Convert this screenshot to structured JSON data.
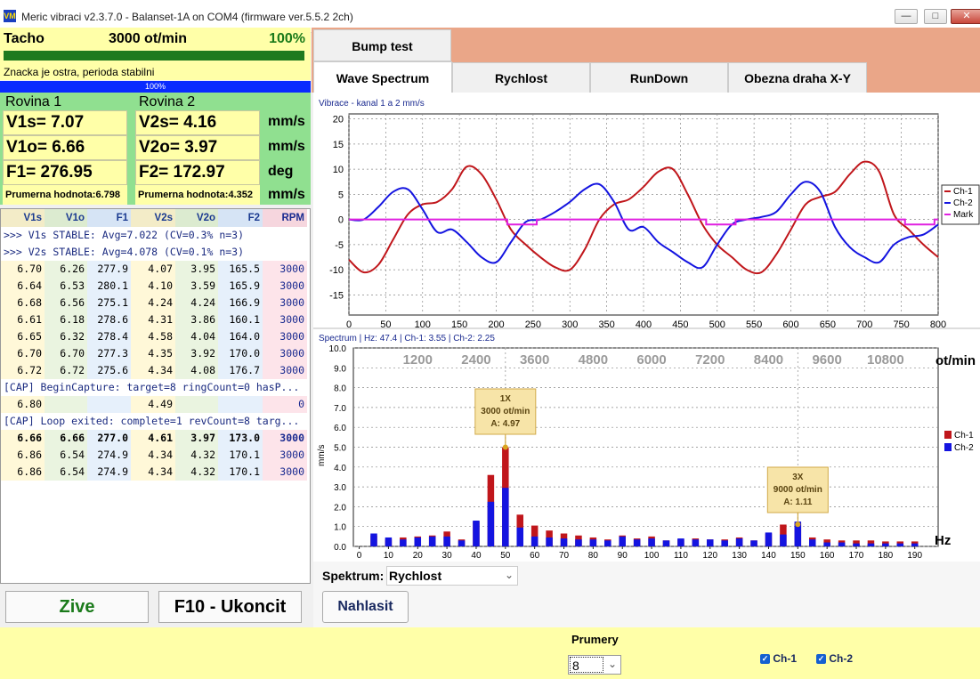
{
  "window": {
    "title": "Meric vibraci v2.3.7.0 - Balanset-1A on COM4 (firmware ver.5.5.2 2ch)",
    "logo_text": "VM"
  },
  "tacho": {
    "label": "Tacho",
    "rpm": "3000 ot/min",
    "percent": "100%",
    "message": "Znacka je ostra, perioda stabilni",
    "progress_label": "100%",
    "progress": 1.0
  },
  "planes": {
    "plane1": {
      "title": "Rovina 1",
      "v1s": "V1s= 7.07",
      "v1o": "V1o= 6.66",
      "f1": "F1= 276.95",
      "avg": "Prumerna hodnota:6.798"
    },
    "plane2": {
      "title": "Rovina 2",
      "v2s": "V2s= 4.16",
      "v2o": "V2o= 3.97",
      "f2": "F2= 172.97",
      "avg": "Prumerna hodnota:4.352"
    },
    "units": [
      "mm/s",
      "mm/s",
      "deg",
      "mm/s"
    ]
  },
  "table": {
    "headers": [
      "V1s",
      "V1o",
      "F1",
      "V2s",
      "V2o",
      "F2",
      "RPM"
    ],
    "log1": ">>> V1s STABLE: Avg=7.022 (CV=0.3% n=3)",
    "log2": ">>> V2s STABLE: Avg=4.078 (CV=0.1% n=3)",
    "rows_a": [
      [
        "6.70",
        "6.26",
        "277.9",
        "4.07",
        "3.95",
        "165.5",
        "3000"
      ],
      [
        "6.64",
        "6.53",
        "280.1",
        "4.10",
        "3.59",
        "165.9",
        "3000"
      ],
      [
        "6.68",
        "6.56",
        "275.1",
        "4.24",
        "4.24",
        "166.9",
        "3000"
      ],
      [
        "6.61",
        "6.18",
        "278.6",
        "4.31",
        "3.86",
        "160.1",
        "3000"
      ],
      [
        "6.65",
        "6.32",
        "278.4",
        "4.58",
        "4.04",
        "164.0",
        "3000"
      ],
      [
        "6.70",
        "6.70",
        "277.3",
        "4.35",
        "3.92",
        "170.0",
        "3000"
      ],
      [
        "6.72",
        "6.72",
        "275.6",
        "4.34",
        "4.08",
        "176.7",
        "3000"
      ]
    ],
    "log3": "[CAP] BeginCapture: target=8 ringCount=0 hasP...",
    "row_b": [
      "6.80",
      "",
      "",
      "4.49",
      "",
      "",
      "0"
    ],
    "log4": "[CAP] Loop exited: complete=1 revCount=8 targ...",
    "rows_c": [
      [
        "6.66",
        "6.66",
        "277.0",
        "4.61",
        "3.97",
        "173.0",
        "3000"
      ],
      [
        "6.86",
        "6.54",
        "274.9",
        "4.34",
        "4.32",
        "170.1",
        "3000"
      ],
      [
        "6.86",
        "6.54",
        "274.9",
        "4.34",
        "4.32",
        "170.1",
        "3000"
      ]
    ]
  },
  "buttons": {
    "live": "Zive",
    "quit": "F10 - Ukoncit",
    "report": "Nahlasit"
  },
  "tabs": {
    "bump": "Bump test",
    "wave": "Wave Spectrum",
    "speed": "Rychlost",
    "rundown": "RunDown",
    "orbit": "Obezna draha X-Y"
  },
  "spectrum_select": {
    "label": "Spektrum:",
    "value": "Rychlost"
  },
  "averages": {
    "label": "Prumery",
    "value": "8"
  },
  "channels": {
    "ch1": "Ch-1",
    "ch2": "Ch-2"
  },
  "colors": {
    "ch1": "#c0161b",
    "ch2": "#1414e0",
    "mark": "#e020e0",
    "tabs_bg": "#eaa688",
    "panel_yellow": "#ffffa8",
    "panel_green": "#90e090"
  },
  "chart_data": [
    {
      "type": "line",
      "title": "Vibrace  - kanal 1 a 2 mm/s",
      "xlim": [
        0,
        800
      ],
      "ylim": [
        -19,
        21
      ],
      "xticks": [
        0,
        50,
        100,
        150,
        200,
        250,
        300,
        350,
        400,
        450,
        500,
        550,
        600,
        650,
        700,
        750,
        800
      ],
      "yticks": [
        20,
        15,
        10,
        5,
        0,
        -5,
        -10,
        -15
      ],
      "grid": true,
      "legend": "right",
      "series": [
        {
          "name": "Ch-1",
          "x": [
            0,
            20,
            40,
            60,
            80,
            100,
            120,
            140,
            160,
            180,
            200,
            220,
            240,
            260,
            280,
            300,
            320,
            340,
            360,
            380,
            400,
            420,
            440,
            460,
            480,
            500,
            520,
            540,
            560,
            580,
            600,
            620,
            640,
            660,
            680,
            700,
            720,
            740,
            760,
            780,
            800
          ],
          "y": [
            -8,
            -10.5,
            -9,
            -4,
            1,
            3,
            3.5,
            6,
            10.5,
            9,
            4,
            -2,
            -5,
            -7.5,
            -9.5,
            -10,
            -6,
            0,
            3,
            4,
            6.5,
            9.5,
            10,
            5,
            -1,
            -5,
            -7.5,
            -10,
            -10.5,
            -7,
            -2,
            3,
            4.5,
            5.5,
            9,
            11.5,
            9.5,
            1,
            -2,
            -5,
            -7.5
          ]
        },
        {
          "name": "Ch-2",
          "x": [
            0,
            20,
            40,
            60,
            80,
            100,
            120,
            140,
            160,
            180,
            200,
            220,
            240,
            260,
            280,
            300,
            320,
            340,
            360,
            380,
            400,
            420,
            440,
            460,
            480,
            500,
            520,
            540,
            560,
            580,
            600,
            620,
            640,
            660,
            680,
            700,
            720,
            740,
            760,
            780,
            800
          ],
          "y": [
            0,
            0,
            2.5,
            5.5,
            6,
            2,
            -2.5,
            -2,
            -4.5,
            -7.5,
            -8.5,
            -4.5,
            -0.5,
            0,
            1.5,
            3.5,
            6,
            7,
            3.5,
            -2,
            -1.5,
            -4.5,
            -6.5,
            -8.5,
            -9.5,
            -5,
            -1,
            0,
            0.5,
            1.5,
            5,
            7.5,
            5.5,
            -1.5,
            -5.5,
            -7.5,
            -8.5,
            -5,
            -3.5,
            -3,
            -1
          ]
        },
        {
          "name": "Mark",
          "x": [
            0,
            215,
            215,
            255,
            255,
            485,
            485,
            525,
            525,
            755,
            755,
            795,
            795,
            800
          ],
          "y": [
            0,
            0,
            -1,
            -1,
            0,
            0,
            -1,
            -1,
            0,
            0,
            -1,
            -1,
            0,
            0
          ]
        }
      ]
    },
    {
      "type": "bar",
      "title": "Spectrum | Hz: 47.4 | Ch-1: 3.55 | Ch-2: 2.25",
      "xlabel": "Hz",
      "ylabel": "mm/s",
      "xlim": [
        -2,
        198
      ],
      "ylim": [
        0,
        10
      ],
      "xticks": [
        0,
        10,
        20,
        30,
        40,
        50,
        60,
        70,
        80,
        90,
        100,
        110,
        120,
        130,
        140,
        150,
        160,
        170,
        180,
        190
      ],
      "yticks": [
        0,
        1,
        2,
        3,
        4,
        5,
        6,
        7,
        8,
        9,
        10
      ],
      "rpm_axis_label": "ot/min",
      "rpm_ticks": [
        "1200",
        "2400",
        "3600",
        "4800",
        "6000",
        "7200",
        "8400",
        "9600",
        "10800"
      ],
      "rpm_tick_hz": [
        20,
        40,
        60,
        80,
        100,
        120,
        140,
        160,
        180
      ],
      "vertical_markers_hz": [
        50,
        150
      ],
      "legend": "right",
      "x": [
        5,
        10,
        15,
        20,
        25,
        30,
        35,
        40,
        45,
        50,
        55,
        60,
        65,
        70,
        75,
        80,
        85,
        90,
        95,
        100,
        105,
        110,
        115,
        120,
        125,
        130,
        135,
        140,
        145,
        150,
        155,
        160,
        165,
        170,
        175,
        180,
        185,
        190
      ],
      "series": [
        {
          "name": "Ch-1",
          "values": [
            0.55,
            0.35,
            0.45,
            0.5,
            0.55,
            0.75,
            0.35,
            1.25,
            3.6,
            5.0,
            1.6,
            1.05,
            0.8,
            0.65,
            0.55,
            0.45,
            0.35,
            0.55,
            0.4,
            0.5,
            0.3,
            0.35,
            0.4,
            0.35,
            0.35,
            0.45,
            0.3,
            0.65,
            1.1,
            1.15,
            0.45,
            0.35,
            0.3,
            0.3,
            0.3,
            0.25,
            0.25,
            0.25
          ]
        },
        {
          "name": "Ch-2",
          "values": [
            0.65,
            0.45,
            0.35,
            0.45,
            0.5,
            0.5,
            0.3,
            1.3,
            2.25,
            2.95,
            0.95,
            0.5,
            0.45,
            0.4,
            0.35,
            0.35,
            0.3,
            0.5,
            0.35,
            0.4,
            0.3,
            0.4,
            0.35,
            0.35,
            0.3,
            0.4,
            0.3,
            0.7,
            0.6,
            1.25,
            0.35,
            0.2,
            0.2,
            0.15,
            0.15,
            0.15,
            0.15,
            0.15
          ]
        }
      ],
      "annotations": [
        {
          "x": 50,
          "y": 5.0,
          "lines": [
            "1X",
            "3000 ot/min",
            "A: 4.97"
          ]
        },
        {
          "x": 150,
          "y": 1.11,
          "lines": [
            "3X",
            "9000 ot/min",
            "A: 1.11"
          ]
        }
      ]
    }
  ]
}
